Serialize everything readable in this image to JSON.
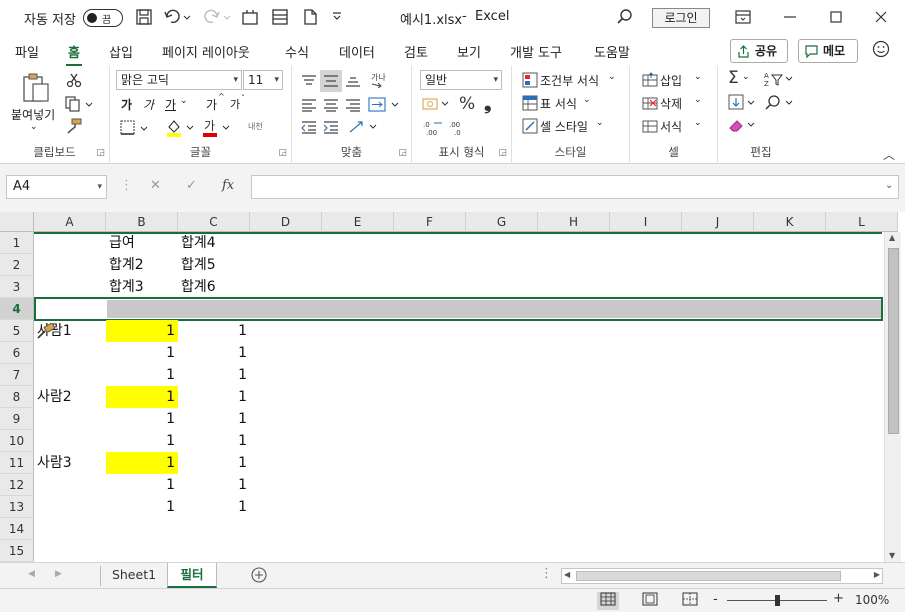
{
  "titlebar": {
    "autosave_label": "자동 저장",
    "autosave_state": "끔",
    "filename": "예시1.xlsx",
    "separator": "-",
    "app_name": "Excel",
    "login_label": "로그인"
  },
  "menu": {
    "tabs": [
      "파일",
      "홈",
      "삽입",
      "페이지 레이아웃",
      "수식",
      "데이터",
      "검토",
      "보기",
      "개발 도구",
      "도움말"
    ],
    "active_tab": "홈",
    "share_label": "공유",
    "memo_label": "메모"
  },
  "ribbon": {
    "clipboard": {
      "paste_label": "붙여넣기",
      "group_label": "클립보드"
    },
    "font": {
      "font_name": "맑은 고딕",
      "font_size": "11",
      "group_label": "글꼴",
      "bold": "가",
      "italic": "가",
      "underline": "가",
      "grow": "가",
      "shrink": "가",
      "phonetic": "내천"
    },
    "alignment": {
      "group_label": "맞춤"
    },
    "number": {
      "format": "일반",
      "group_label": "표시 형식"
    },
    "styles": {
      "conditional": "조건부 서식",
      "table": "표 서식",
      "cell_style": "셀 스타일",
      "group_label": "스타일"
    },
    "cells": {
      "insert": "삽입",
      "delete": "삭제",
      "format": "서식",
      "group_label": "셀"
    },
    "editing": {
      "group_label": "편집"
    }
  },
  "formula_bar": {
    "name_box": "A4",
    "content": ""
  },
  "grid": {
    "columns": [
      "A",
      "B",
      "C",
      "D",
      "E",
      "F",
      "G",
      "H",
      "I",
      "J",
      "K",
      "L"
    ],
    "rows": [
      "1",
      "2",
      "3",
      "4",
      "5",
      "6",
      "7",
      "8",
      "9",
      "10",
      "11",
      "12",
      "13",
      "14",
      "15"
    ],
    "selected_row": "4",
    "cells": {
      "B1": "급여",
      "C1": "합계4",
      "B2": "합계2",
      "C2": "합계5",
      "B3": "합계3",
      "C3": "합계6",
      "A5": "사람1",
      "B5": "1",
      "C5": "1",
      "B6": "1",
      "C6": "1",
      "B7": "1",
      "C7": "1",
      "A8": "사람2",
      "B8": "1",
      "C8": "1",
      "B9": "1",
      "C9": "1",
      "B10": "1",
      "C10": "1",
      "A11": "사람3",
      "B11": "1",
      "C11": "1",
      "B12": "1",
      "C12": "1",
      "B13": "1",
      "C13": "1"
    },
    "highlight_color": "#ffff00",
    "selection_color": "#1a6e3b"
  },
  "sheets": {
    "tabs": [
      "Sheet1",
      "필터"
    ],
    "active": "필터",
    "add_icon": "plus-circle-icon"
  },
  "statusbar": {
    "zoom": "100%",
    "zoom_minus": "-",
    "zoom_plus": "+"
  }
}
